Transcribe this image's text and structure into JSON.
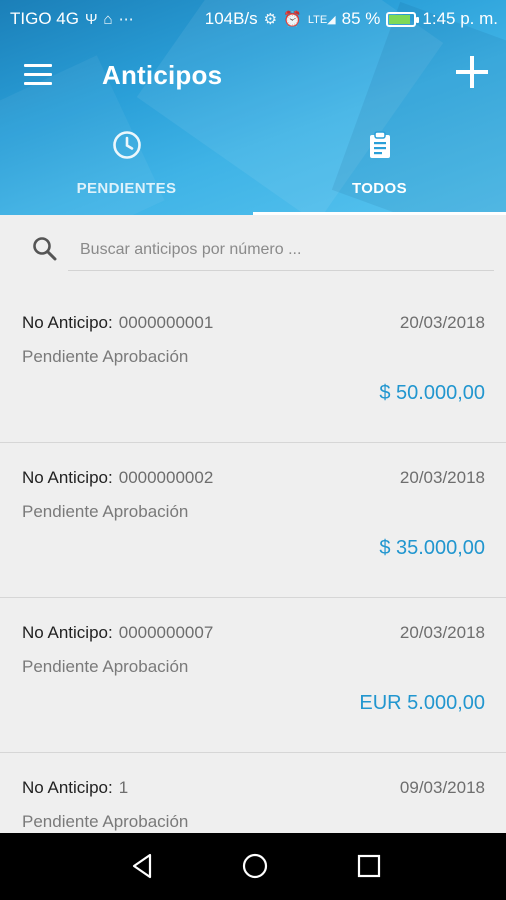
{
  "status_bar": {
    "carrier": "TIGO 4G",
    "speed": "104B/s",
    "network": "LTE",
    "battery": "85 %",
    "battery_level": 0.85,
    "time": "1:45 p. m."
  },
  "toolbar": {
    "title": "Anticipos",
    "menu_icon": "hamburger-menu-icon",
    "add_icon": "plus-icon"
  },
  "tabs": [
    {
      "label": "PENDIENTES",
      "icon": "clock-icon",
      "selected": false
    },
    {
      "label": "TODOS",
      "icon": "clipboard-icon",
      "selected": true
    }
  ],
  "search": {
    "placeholder": "Buscar anticipos por número ...",
    "value": ""
  },
  "list": {
    "number_label": "No Anticipo:",
    "items": [
      {
        "number": "0000000001",
        "date": "20/03/2018",
        "status": "Pendiente Aprobación",
        "amount": "$ 50.000,00"
      },
      {
        "number": "0000000002",
        "date": "20/03/2018",
        "status": "Pendiente Aprobación",
        "amount": "$ 35.000,00"
      },
      {
        "number": "0000000007",
        "date": "20/03/2018",
        "status": "Pendiente Aprobación",
        "amount": "EUR 5.000,00"
      },
      {
        "number": "1",
        "date": "09/03/2018",
        "status": "Pendiente Aprobación",
        "amount": ""
      }
    ]
  },
  "colors": {
    "header_gradient_start": "#1b7fb8",
    "header_gradient_end": "#58c4ef",
    "amount": "#2196cf",
    "background": "#efefef"
  }
}
